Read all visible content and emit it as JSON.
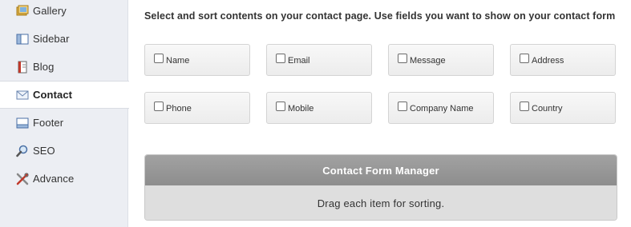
{
  "sidebar": {
    "items": [
      {
        "label": "Gallery",
        "icon": "gallery-icon"
      },
      {
        "label": "Sidebar",
        "icon": "sidebar-icon"
      },
      {
        "label": "Blog",
        "icon": "blog-icon"
      },
      {
        "label": "Contact",
        "icon": "contact-icon",
        "active": true
      },
      {
        "label": "Footer",
        "icon": "footer-icon"
      },
      {
        "label": "SEO",
        "icon": "seo-icon"
      },
      {
        "label": "Advance",
        "icon": "advance-icon"
      }
    ]
  },
  "main": {
    "instruction": "Select and sort contents on your contact page. Use fields you want to show on your contact form",
    "fields": [
      {
        "label": "Name",
        "checked": false
      },
      {
        "label": "Email",
        "checked": false
      },
      {
        "label": "Message",
        "checked": false
      },
      {
        "label": "Address",
        "checked": false
      },
      {
        "label": "Phone",
        "checked": false
      },
      {
        "label": "Mobile",
        "checked": false
      },
      {
        "label": "Company Name",
        "checked": false
      },
      {
        "label": "Country",
        "checked": false
      }
    ],
    "manager": {
      "title": "Contact Form Manager",
      "hint": "Drag each item for sorting."
    }
  },
  "colors": {
    "sidebar_bg": "#eceef3",
    "active_bg": "#ffffff",
    "manager_header": "#969696",
    "manager_body": "#dedede"
  }
}
